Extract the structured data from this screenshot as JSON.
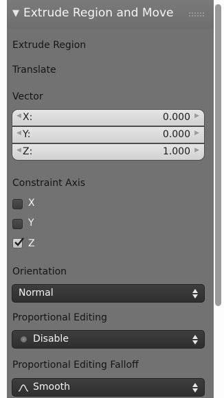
{
  "header": {
    "title": "Extrude Region and Move",
    "collapse_icon": "triangle-down-icon",
    "grip_icon": "drag-grip-icon"
  },
  "sections": {
    "extrude_region": "Extrude Region",
    "translate": "Translate",
    "vector": "Vector",
    "constraint_axis": "Constraint Axis",
    "orientation": "Orientation",
    "proportional_editing": "Proportional Editing",
    "proportional_falloff": "Proportional Editing Falloff"
  },
  "vector": [
    {
      "name": "X:",
      "value": "0.000"
    },
    {
      "name": "Y:",
      "value": "0.000"
    },
    {
      "name": "Z:",
      "value": "1.000"
    }
  ],
  "constraint_axis": [
    {
      "label": "X",
      "checked": false
    },
    {
      "label": "Y",
      "checked": false
    },
    {
      "label": "Z",
      "checked": true
    }
  ],
  "orientation": {
    "value": "Normal"
  },
  "proportional_editing": {
    "value": "Disable",
    "icon": "disabled-dot-icon"
  },
  "proportional_falloff": {
    "value": "Smooth",
    "icon": "smooth-curve-icon"
  },
  "colors": {
    "panel_bg": "#727272",
    "field_bg": "#d8d8d8",
    "dropdown_bg": "#353535",
    "text_dark": "#151515",
    "text_light": "#f4f4f4"
  }
}
